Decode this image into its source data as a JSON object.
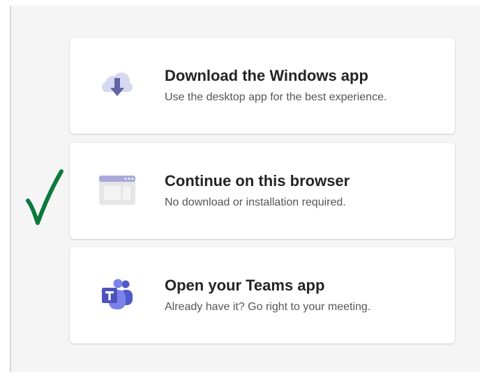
{
  "options": [
    {
      "title": "Download the Windows app",
      "subtitle": "Use the desktop app for the best experience.",
      "icon": "cloud-download-icon"
    },
    {
      "title": "Continue on this browser",
      "subtitle": "No download or installation required.",
      "icon": "browser-window-icon"
    },
    {
      "title": "Open your Teams app",
      "subtitle": "Already have it? Go right to your meeting.",
      "icon": "teams-icon"
    }
  ],
  "colors": {
    "accent": "#6264a7",
    "icon_light": "#d6d8f0",
    "checkmark": "#0a7a3c"
  },
  "annotation": {
    "checkmark_target": "Continue on this browser"
  }
}
